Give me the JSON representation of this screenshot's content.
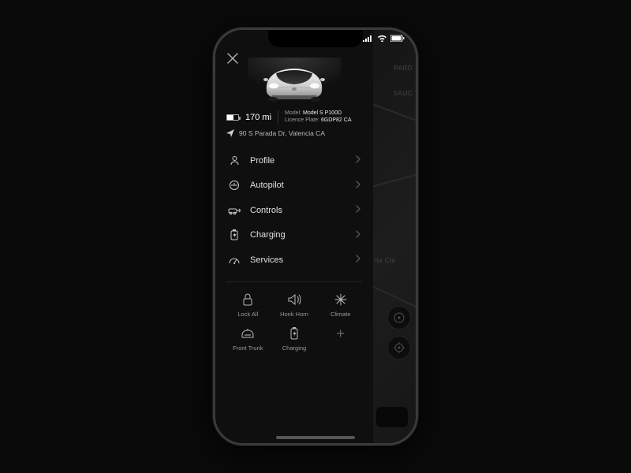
{
  "vehicle": {
    "range": "170 mi",
    "battery_pct": 55,
    "model_label": "Model:",
    "model_value": "Model S P100D",
    "plate_label": "Licence Plate:",
    "plate_value": "6GDP82 CA",
    "location": "90 S Parada Dr, Valencia CA"
  },
  "menu": [
    {
      "id": "profile",
      "label": "Profile"
    },
    {
      "id": "autopilot",
      "label": "Autopilot"
    },
    {
      "id": "controls",
      "label": "Controls"
    },
    {
      "id": "charging",
      "label": "Charging"
    },
    {
      "id": "services",
      "label": "Services"
    }
  ],
  "quick_actions": [
    {
      "id": "lock",
      "label": "Lock All"
    },
    {
      "id": "horn",
      "label": "Honk Horn"
    },
    {
      "id": "climate",
      "label": "Climate"
    },
    {
      "id": "frunk",
      "label": "Front Trunk"
    },
    {
      "id": "charge",
      "label": "Charging"
    },
    {
      "id": "add",
      "label": ""
    }
  ],
  "map": {
    "label1": "PARD",
    "label2": "SAUC",
    "label3": "ita Cla"
  }
}
